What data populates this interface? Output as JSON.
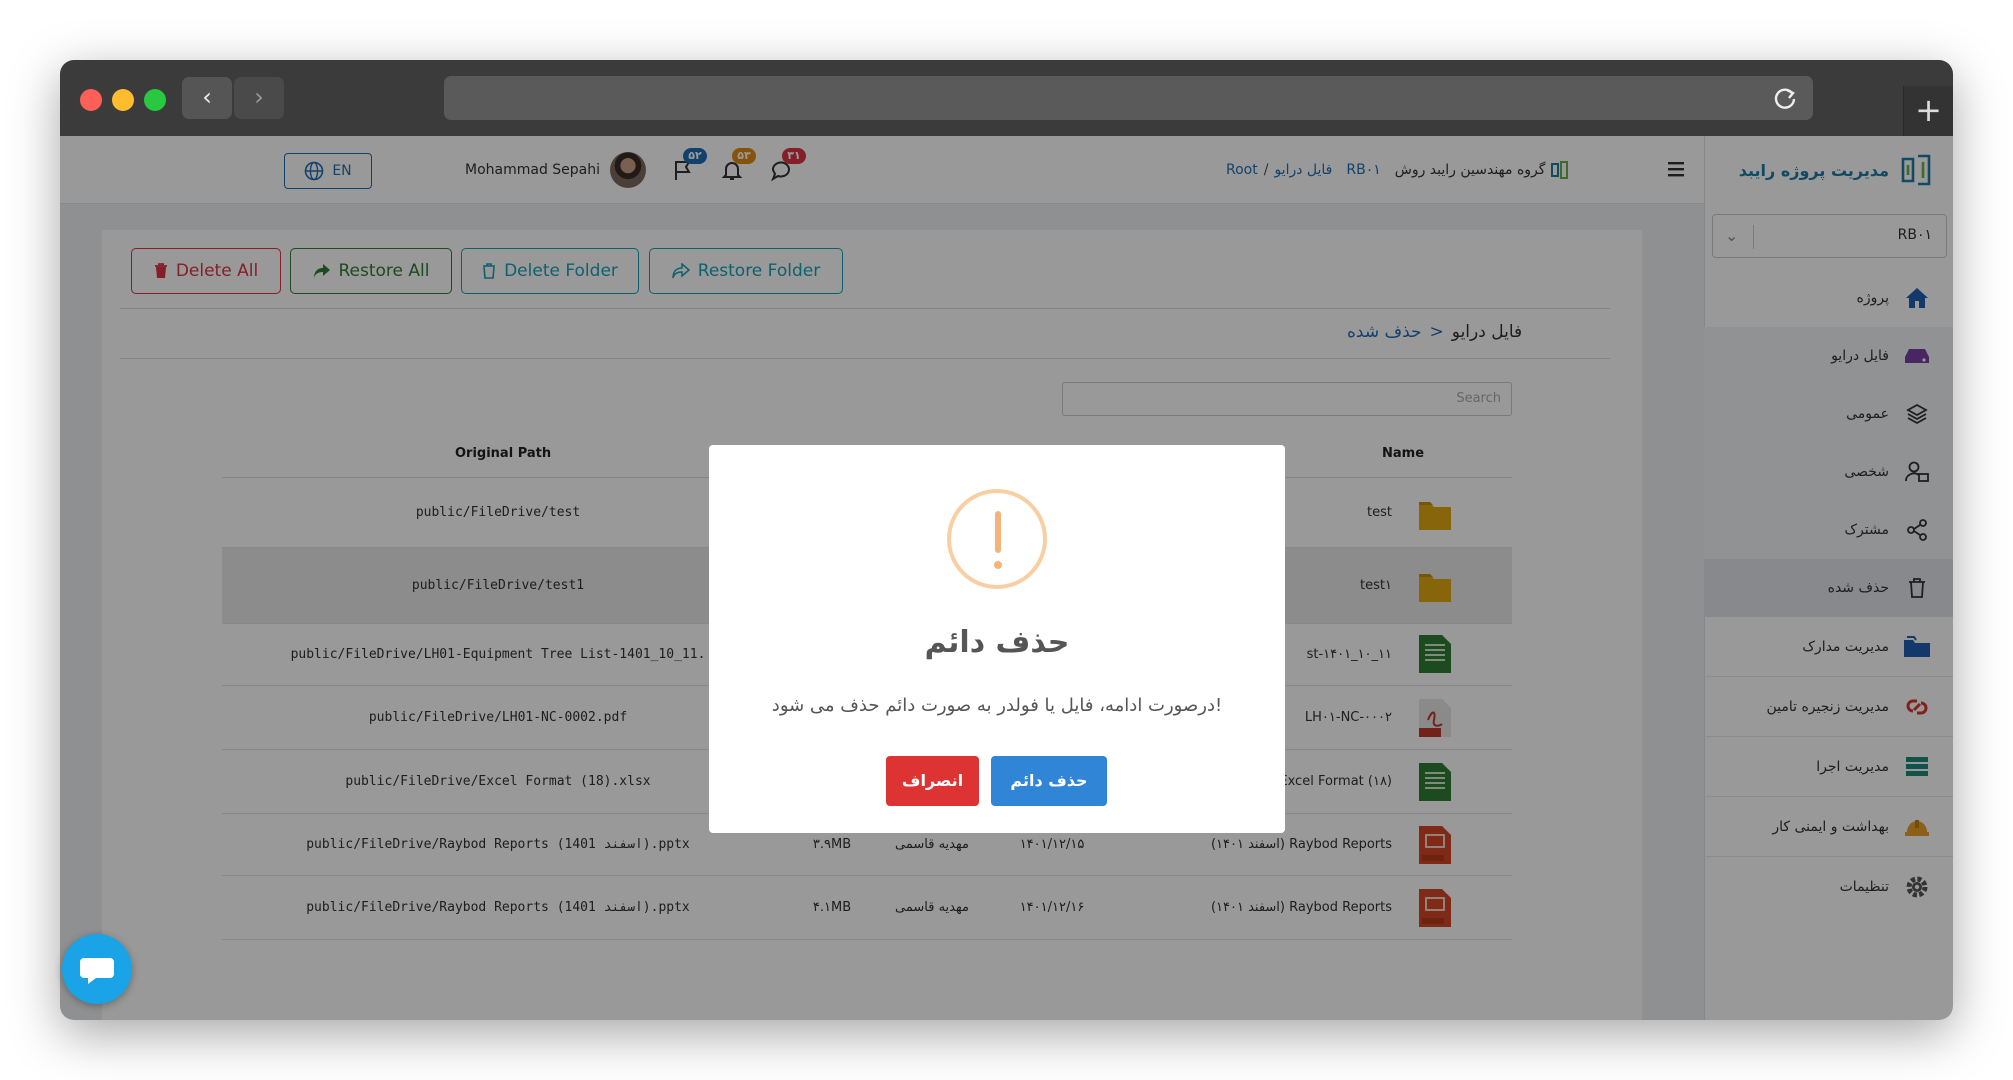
{
  "browser": {
    "back_glyph": "‹",
    "forward_glyph": "›",
    "new_tab_glyph": "+",
    "url": ""
  },
  "header": {
    "hamburger": "menu-icon",
    "breadcrumb": {
      "org": "گروه مهندسین رایبد روش",
      "project": "RB۰۱",
      "sep": "/",
      "drive": "فایل درایو",
      "root": "Root"
    },
    "badges": {
      "messages": "۳۱",
      "notifications": "۵۳",
      "flags": "۵۲"
    },
    "user_name": "Mohammad Sepahi",
    "lang_label": "EN"
  },
  "sidebar": {
    "brand": "مدیریت پروژه رایبد",
    "project_select": "RB۰۱",
    "items": [
      {
        "label": "پروژه",
        "icon": "home-icon"
      },
      {
        "label": "فایل درایو",
        "icon": "drive-icon"
      },
      {
        "label": "عمومی",
        "icon": "layers-icon"
      },
      {
        "label": "شخصی",
        "icon": "user-lock-icon"
      },
      {
        "label": "مشترک",
        "icon": "share-icon"
      },
      {
        "label": "حذف شده",
        "icon": "trash-icon"
      },
      {
        "label": "مدیریت مدارک",
        "icon": "folder-icon"
      },
      {
        "label": "مدیریت زنجیره تامین",
        "icon": "supply-chain-icon"
      },
      {
        "label": "مدیریت اجرا",
        "icon": "execution-icon"
      },
      {
        "label": "بهداشت و ایمنی کار",
        "icon": "helmet-icon"
      },
      {
        "label": "تنظیمات",
        "icon": "gear-icon"
      }
    ]
  },
  "toolbar": {
    "delete_all": "Delete All",
    "restore_all": "Restore All",
    "delete_folder": "Delete Folder",
    "restore_folder": "Restore Folder"
  },
  "path_title": {
    "root": "فایل درایو",
    "sep": ">",
    "current": "حذف شده"
  },
  "search": {
    "placeholder": "Search"
  },
  "table": {
    "headers": {
      "original_path": "Original Path",
      "name": "Name"
    },
    "rows": [
      {
        "path": "public/FileDrive/test",
        "size": "",
        "owner": "",
        "date": "",
        "name": "test",
        "type": "folder"
      },
      {
        "path": "public/FileDrive/test1",
        "size": "",
        "owner": "",
        "date": "",
        "name": "test۱",
        "type": "folder"
      },
      {
        "path": "public/FileDrive/LH01-Equipment Tree List-1401_10_11.",
        "size": "",
        "owner": "",
        "date": "",
        "name": "st-۱۴۰۱_۱۰_۱۱",
        "type": "xlsx"
      },
      {
        "path": "public/FileDrive/LH01-NC-0002.pdf",
        "size": "",
        "owner": "",
        "date": "",
        "name": "LH۰۱-NC-۰۰۰۲",
        "type": "pdf"
      },
      {
        "path": "public/FileDrive/Excel Format (18).xlsx",
        "size": "",
        "owner": "",
        "date": "",
        "name": "Excel Format (۱۸)",
        "type": "xlsx"
      },
      {
        "path": "public/FileDrive/Raybod Reports (1401 اسفند).pptx",
        "size": "۳.۹MB",
        "owner": "مهدیه قاسمی",
        "date": "۱۴۰۱/۱۲/۱۵",
        "name": "(اسفند ۱۴۰۱) Raybod Reports",
        "type": "pptx"
      },
      {
        "path": "public/FileDrive/Raybod Reports (1401 اسفند).pptx",
        "size": "۴.۱MB",
        "owner": "مهدیه قاسمی",
        "date": "۱۴۰۱/۱۲/۱۶",
        "name": "(اسفند ۱۴۰۱) Raybod Reports",
        "type": "pptx"
      }
    ]
  },
  "modal": {
    "icon": "warning-icon",
    "title": "حذف دائم",
    "text": "درصورت ادامه، فایل یا فولدر به صورت دائم حذف می شود!",
    "confirm": "حذف دائم",
    "cancel": "انصراف"
  },
  "colors": {
    "primary": "#1f6fb5",
    "danger": "#dc3545",
    "success": "#2e7d32",
    "info": "#17a2b8",
    "brand": "#1f7aa5",
    "confirm_btn": "#3085d6",
    "cancel_btn": "#dd3333"
  }
}
